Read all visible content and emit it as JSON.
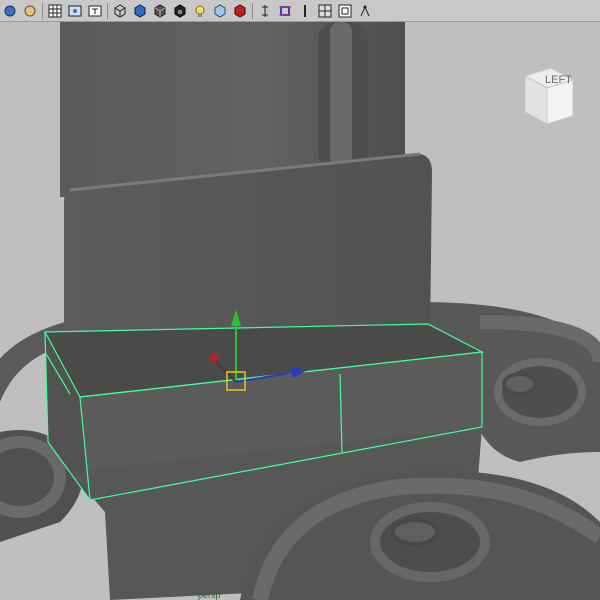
{
  "toolbar": {
    "buttons": [
      {
        "icon": "camera-select-icon"
      },
      {
        "icon": "camera-attributes-icon"
      },
      {
        "icon": "grid-toggle-icon"
      },
      {
        "icon": "film-gate-icon"
      },
      {
        "icon": "resolution-gate-icon"
      },
      {
        "icon": "wireframe-icon"
      },
      {
        "icon": "smooth-shade-icon"
      },
      {
        "icon": "smooth-shade-wireframe-icon"
      },
      {
        "icon": "textured-icon"
      },
      {
        "icon": "use-all-lights-icon"
      },
      {
        "icon": "shadows-icon"
      },
      {
        "icon": "isolate-select-icon"
      },
      {
        "icon": "xray-icon"
      },
      {
        "icon": "xray-joints-icon"
      },
      {
        "icon": "backface-culling-icon"
      },
      {
        "icon": "image-plane-icon"
      },
      {
        "icon": "pivot-icon"
      }
    ]
  },
  "viewport": {
    "viewcube_label": "LEFT",
    "camera_label": "persp",
    "colors": {
      "background": "#bfbfbf",
      "mesh": "#5e5e5e",
      "selection": "#40ff9a",
      "manipulator_y": "#2dbf3a",
      "manipulator_x": "#c02020",
      "manipulator_z": "#2a3ab8",
      "pivot": "#e8c61a"
    }
  }
}
